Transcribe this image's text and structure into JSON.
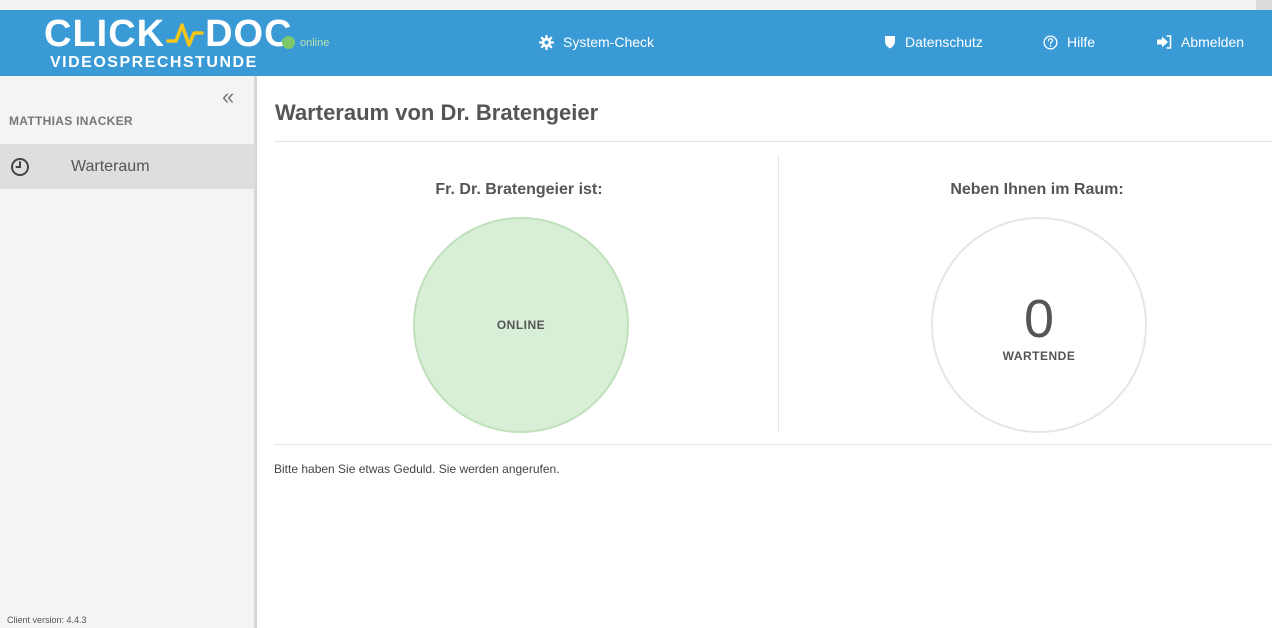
{
  "header": {
    "logo_main_left": "CLICK",
    "logo_main_right": "DOC",
    "logo_sub": "VIDEOSPRECHSTUNDE",
    "status_text": "online",
    "system_check": "System-Check",
    "datenschutz": "Datenschutz",
    "hilfe": "Hilfe",
    "abmelden": "Abmelden"
  },
  "sidebar": {
    "collapse_glyph": "«",
    "user_name": "MATTHIAS INACKER",
    "items": [
      {
        "label": "Warteraum",
        "icon": "clock-icon"
      }
    ],
    "client_version": "Client version: 4.4.3"
  },
  "main": {
    "title": "Warteraum von Dr. Bratengeier",
    "left_heading": "Fr. Dr. Bratengeier ist:",
    "left_state": "ONLINE",
    "right_heading": "Neben Ihnen im Raum:",
    "right_count": "0",
    "right_label": "WARTENDE",
    "message": "Bitte haben Sie etwas Geduld. Sie werden angerufen."
  },
  "colors": {
    "header_bg": "#3a9ad6",
    "online_circle": "#d9eed7",
    "status_dot": "#7dc86a",
    "logo_wave": "#f5c518"
  }
}
